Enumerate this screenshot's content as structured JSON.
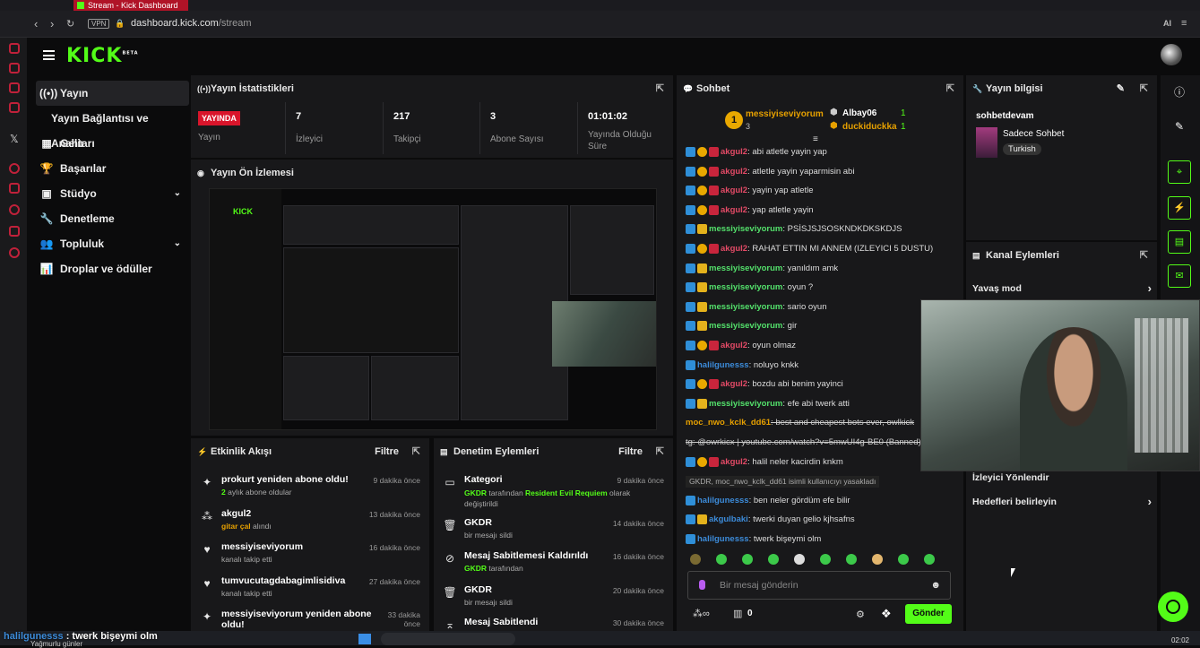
{
  "browser": {
    "tab_title": "Stream - Kick Dashboard",
    "url_domain": "dashboard.kick.com",
    "url_path": "/stream",
    "vpn_label": "VPN",
    "ai_label": "AI"
  },
  "brand": {
    "logo_text": "KICK",
    "logo_sup": "BETA",
    "accent": "#53fc18"
  },
  "sidebar": {
    "items": [
      {
        "label": "Yayın",
        "icon": "broadcast-icon",
        "active": true
      },
      {
        "label": "Yayın Bağlantısı ve Anahtarı",
        "sub": true
      },
      {
        "label": "Gelir",
        "icon": "revenue-icon"
      },
      {
        "label": "Başarılar",
        "icon": "trophy-icon"
      },
      {
        "label": "Stüdyo",
        "icon": "studio-icon",
        "expandable": true
      },
      {
        "label": "Denetleme",
        "icon": "wrench-icon"
      },
      {
        "label": "Topluluk",
        "icon": "community-icon",
        "expandable": true
      },
      {
        "label": "Droplar ve ödüller",
        "icon": "drops-icon"
      }
    ]
  },
  "stats": {
    "title": "Yayın İstatistikleri",
    "live_badge": "YAYINDA",
    "live_label": "Yayın",
    "items": [
      {
        "value": "7",
        "label": "İzleyici"
      },
      {
        "value": "217",
        "label": "Takipçi"
      },
      {
        "value": "3",
        "label": "Abone Sayısı"
      },
      {
        "value": "01:01:02",
        "label": "Yayında Olduğu Süre"
      }
    ]
  },
  "preview": {
    "title": "Yayın Ön İzlemesi"
  },
  "activity": {
    "title": "Etkinlik Akışı",
    "filter": "Filtre",
    "items": [
      {
        "title": "prokurt yeniden abone oldu!",
        "sub_highlight": "2",
        "sub": " aylık abone oldular",
        "time": "9 dakika önce",
        "icon": "sparkle-icon"
      },
      {
        "title": "akgul2",
        "sub_highlight": "gitar çal",
        "sub": " alındı",
        "time": "13 dakika önce",
        "icon": "reward-icon"
      },
      {
        "title": "messiyiseviyorum",
        "sub_highlight": "",
        "sub": "kanalı takip etti",
        "time": "16 dakika önce",
        "icon": "heart-icon"
      },
      {
        "title": "tumvucutagdabagimlisidiva",
        "sub_highlight": "",
        "sub": "kanalı takip etti",
        "time": "27 dakika önce",
        "icon": "heart-icon"
      },
      {
        "title": "messiyiseviyorum yeniden abone oldu!",
        "sub_highlight": "",
        "sub": "",
        "time": "33 dakika önce",
        "icon": "sparkle-icon"
      }
    ]
  },
  "moderation": {
    "title": "Denetim Eylemleri",
    "filter": "Filtre",
    "items": [
      {
        "title": "Kategori",
        "actor": "GKDR",
        "mid": " tarafından ",
        "target": "Resident Evil Requiem",
        "tail": " olarak değiştirildi",
        "time": "9 dakika önce",
        "icon": "category-icon"
      },
      {
        "title": "GKDR",
        "actor": "",
        "mid": "bir mesajı sildi",
        "target": "",
        "tail": "",
        "time": "14 dakika önce",
        "icon": "trash-icon"
      },
      {
        "title": "Mesaj Sabitlemesi Kaldırıldı",
        "actor": "GKDR",
        "mid": " tarafından",
        "target": "",
        "tail": "",
        "time": "16 dakika önce",
        "icon": "unpin-icon"
      },
      {
        "title": "GKDR",
        "actor": "",
        "mid": "bir mesajı sildi",
        "target": "",
        "tail": "",
        "time": "20 dakika önce",
        "icon": "trash-icon"
      },
      {
        "title": "Mesaj Sabitlendi",
        "actor": "",
        "mid": "",
        "target": "",
        "tail": "",
        "time": "30 dakika önce",
        "icon": "pin-icon"
      }
    ]
  },
  "chat": {
    "title": "Sohbet",
    "top_gifter": {
      "name": "messiyiseviyorum",
      "count": "3",
      "rank": "1"
    },
    "gifters": [
      {
        "name": "Albay06",
        "count": "1"
      },
      {
        "name": "duckiduckka",
        "count": "1"
      }
    ],
    "messages": [
      {
        "user": "akgul2",
        "color": "red",
        "text": ": abi atletle yayin yap"
      },
      {
        "user": "akgul2",
        "color": "red",
        "text": ": atletle yayin yaparmisin abi"
      },
      {
        "user": "akgul2",
        "color": "red",
        "text": ": yayin yap atletle"
      },
      {
        "user": "akgul2",
        "color": "red",
        "text": ": yap atletle yayin"
      },
      {
        "user": "messiyiseviyorum",
        "color": "green",
        "text": ": PSİSJSJSOSKNDKDKSKDJS"
      },
      {
        "user": "akgul2",
        "color": "red",
        "text": ": RAHAT ETTIN MI ANNEM (IZLEYICI 5 DUSTU)"
      },
      {
        "user": "messiyiseviyorum",
        "color": "green",
        "text": ": yanıldım amk"
      },
      {
        "user": "messiyiseviyorum",
        "color": "green",
        "text": ": oyun ?"
      },
      {
        "user": "messiyiseviyorum",
        "color": "green",
        "text": ": sario oyun"
      },
      {
        "user": "messiyiseviyorum",
        "color": "green",
        "text": ": gir"
      },
      {
        "user": "akgul2",
        "color": "red",
        "text": ": oyun olmaz"
      },
      {
        "user": "halilgunesss",
        "color": "blue",
        "text": ": noluyo knkk"
      },
      {
        "user": "akgul2",
        "color": "red",
        "text": ": bozdu abi benim yayinci"
      },
      {
        "user": "messiyiseviyorum",
        "color": "green",
        "text": ": efe abi twerk atti"
      },
      {
        "user": "moc_nwo_kclk_dd61",
        "color": "orange",
        "text": ": best and cheapest bots ever, owlkick"
      },
      {
        "user": "",
        "color": "",
        "text": "tg: @owrkicx | youtube.com/watch?v=5mwUI4g-BE0 (Banned)"
      },
      {
        "user": "akgul2",
        "color": "red",
        "text": ": halil neler kacirdin knkm"
      },
      {
        "user": "",
        "color": "",
        "text": "GKDR, moc_nwo_kclk_dd61 isimli kullanıcıyı yasakladı"
      },
      {
        "user": "halilgunesss",
        "color": "blue",
        "text": ": ben neler gördüm efe bilir"
      },
      {
        "user": "akgulbaki",
        "color": "blue",
        "text": ": twerki duyan gelio kjhsafns"
      },
      {
        "user": "halilgunesss",
        "color": "blue",
        "text": ": twerk bişeymi olm"
      }
    ],
    "input_placeholder": "Bir mesaj gönderin",
    "send_label": "Gönder",
    "points_value": "0"
  },
  "stream_info": {
    "title": "Yayın bilgisi",
    "channel": "sohbetdevam",
    "stream_title": "Sadece Sohbet",
    "language": "Turkish"
  },
  "channel_actions": {
    "title": "Kanal Eylemleri",
    "items": [
      {
        "label": "Yavaş mod"
      },
      {
        "label": "İzleyici Yönlendir"
      },
      {
        "label": "Hedefleri belirleyin"
      }
    ]
  },
  "taskbar": {
    "overlay_user": "halilgunesss",
    "overlay_text": " : twerk bişeymi olm",
    "weather": "Yağmurlu günler",
    "clock": "02:02"
  }
}
